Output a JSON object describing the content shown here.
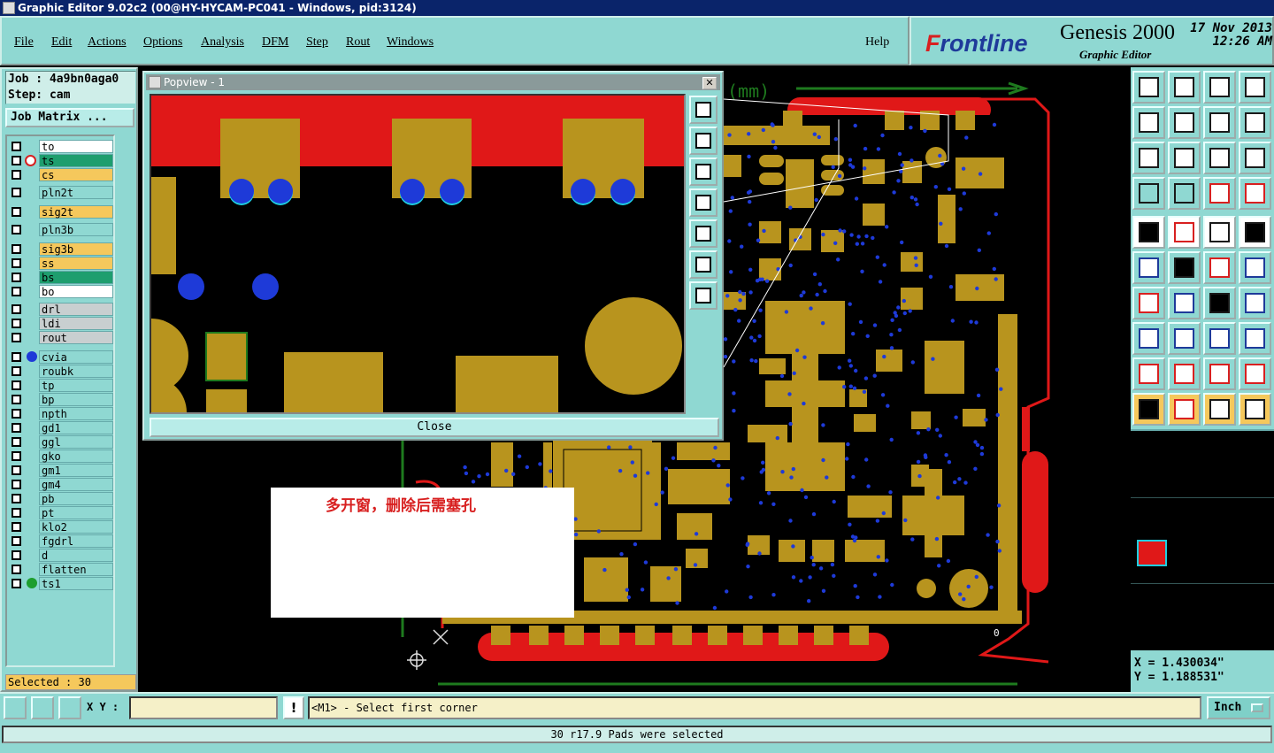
{
  "window": {
    "title": "Graphic Editor 9.02c2 (00@HY-HYCAM-PC041 - Windows, pid:3124)"
  },
  "menu": [
    "File",
    "Edit",
    "Actions",
    "Options",
    "Analysis",
    "DFM",
    "Step",
    "Rout",
    "Windows"
  ],
  "help": "Help",
  "brand": {
    "logo_prefix": "F",
    "logo_rest": "rontline",
    "product": "Genesis 2000",
    "subtitle": "Graphic Editor",
    "date": "17 Nov 2013",
    "time": "12:26 AM"
  },
  "job": {
    "job_line": "Job : 4a9bn0aga0",
    "step_line": "Step: cam",
    "matrix_btn": "Job Matrix ..."
  },
  "layers": [
    {
      "name": "to",
      "color": "#ffffff"
    },
    {
      "name": "ts",
      "color": "#1e9e6e",
      "active": true
    },
    {
      "name": "cs",
      "color": "#f5c85c"
    },
    {
      "name": "pln2t",
      "color": "#8fd8d2"
    },
    {
      "name": "sig2t",
      "color": "#f5c85c"
    },
    {
      "name": "pln3b",
      "color": "#8fd8d2"
    },
    {
      "name": "sig3b",
      "color": "#f5c85c"
    },
    {
      "name": "ss",
      "color": "#f5c85c"
    },
    {
      "name": "bs",
      "color": "#1e9e6e"
    },
    {
      "name": "bo",
      "color": "#ffffff"
    },
    {
      "name": "drl",
      "color": "#c8cfd0"
    },
    {
      "name": "ldi",
      "color": "#c8cfd0"
    },
    {
      "name": "rout",
      "color": "#c8cfd0"
    },
    {
      "name": "cvia",
      "color": "#8fd8d2",
      "marker": "#1e3ad8"
    },
    {
      "name": "roubk",
      "color": "#8fd8d2"
    },
    {
      "name": "tp",
      "color": "#8fd8d2"
    },
    {
      "name": "bp",
      "color": "#8fd8d2"
    },
    {
      "name": "npth",
      "color": "#8fd8d2"
    },
    {
      "name": "gd1",
      "color": "#8fd8d2"
    },
    {
      "name": "ggl",
      "color": "#8fd8d2"
    },
    {
      "name": "gko",
      "color": "#8fd8d2"
    },
    {
      "name": "gm1",
      "color": "#8fd8d2"
    },
    {
      "name": "gm4",
      "color": "#8fd8d2"
    },
    {
      "name": "pb",
      "color": "#8fd8d2"
    },
    {
      "name": "pt",
      "color": "#8fd8d2"
    },
    {
      "name": "klo2",
      "color": "#8fd8d2"
    },
    {
      "name": "fgdrl",
      "color": "#8fd8d2"
    },
    {
      "name": "d",
      "color": "#8fd8d2"
    },
    {
      "name": "flatten",
      "color": "#8fd8d2"
    },
    {
      "name": "ts1",
      "color": "#8fd8d2",
      "marker": "#1e9e2e"
    }
  ],
  "selected": "Selected : 30",
  "popview": {
    "title": "Popview - 1",
    "close": "Close"
  },
  "canvas": {
    "unit_label": "(mm)",
    "note": "多开窗，删除后需塞孔"
  },
  "coords": {
    "x": "X = 1.430034\"",
    "y": "Y = 1.188531\""
  },
  "bottom": {
    "xy_label": "X Y :",
    "xy_value": "",
    "warn": "!",
    "prompt": "<M1> - Select first corner",
    "units": "Inch"
  },
  "status": "30 r17.9 Pads were selected",
  "colors": {
    "panel": "#8fd8d2",
    "copper": "#b8941e",
    "mask": "#e01818",
    "via": "#1e3ad8",
    "board": "#1e7a1e"
  }
}
